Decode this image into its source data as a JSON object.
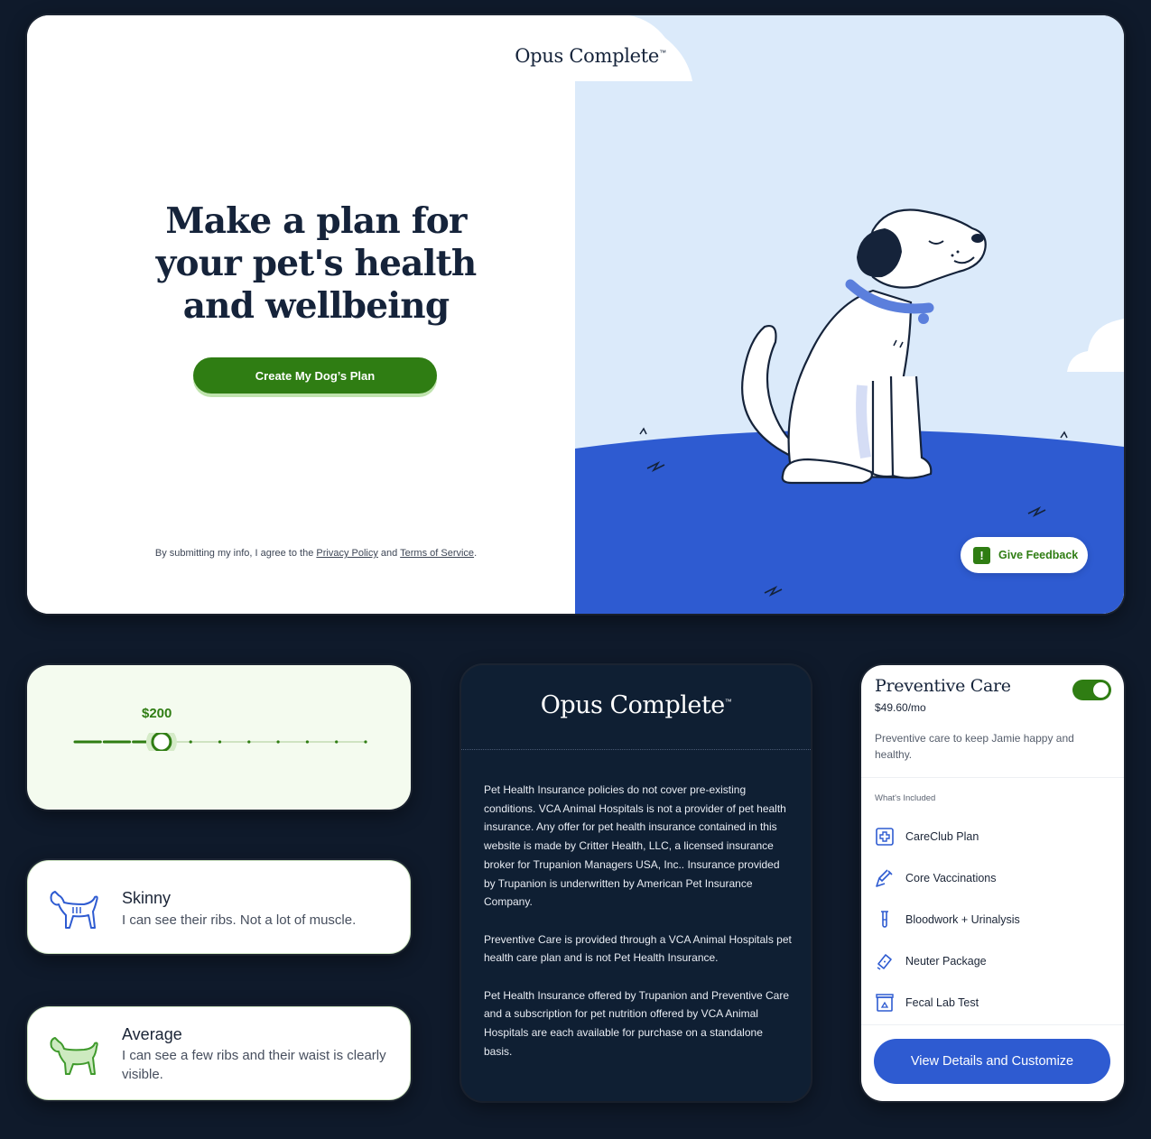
{
  "hero": {
    "brand": "Opus Complete",
    "brand_tm": "™",
    "title": "Make a plan for your pet's health and wellbeing",
    "cta_label": "Create My Dog’s Plan",
    "legal_prefix": "By submitting my info, I agree to the ",
    "privacy_link": "Privacy Policy",
    "legal_and": " and ",
    "terms_link": "Terms of Service",
    "legal_suffix": ".",
    "feedback_label": "Give Feedback",
    "feedback_icon": "!"
  },
  "slider": {
    "value_label": "$200",
    "selected_index": 3,
    "step_count": 11
  },
  "body_types": [
    {
      "title": "Skinny",
      "description": "I can see their ribs. Not a lot of muscle.",
      "icon": "skinny-dog-icon",
      "color": "#2e5bd1"
    },
    {
      "title": "Average",
      "description": "I can see a few ribs and their waist is clearly visible.",
      "icon": "average-dog-icon",
      "color": "#3f9a2c"
    }
  ],
  "disclaimer": {
    "brand": "Opus Complete",
    "brand_tm": "™",
    "paragraphs": [
      "Pet Health Insurance policies do not cover pre-existing conditions.  VCA Animal Hospitals is not a provider of pet health insurance. Any offer for pet health insurance contained in this website is made by Critter Health, LLC, a licensed insurance broker for Trupanion Managers USA, Inc.. Insurance provided by Trupanion is underwritten by American Pet Insurance Company.",
      "Preventive Care is provided through a VCA Animal Hospitals pet health care plan and is not Pet Health Insurance.",
      "Pet Health Insurance offered by Trupanion and Preventive Care and a subscription for pet nutrition offered by VCA Animal Hospitals are each available for purchase on a standalone basis."
    ]
  },
  "plan": {
    "title": "Preventive Care",
    "price": "$49.60/mo",
    "toggle_on": true,
    "description": "Preventive care to keep Jamie happy and healthy.",
    "included_label": "What's Included",
    "items": [
      {
        "label": "CareClub Plan",
        "icon": "medical-cross-icon"
      },
      {
        "label": "Core Vaccinations",
        "icon": "syringe-icon"
      },
      {
        "label": "Bloodwork + Urinalysis",
        "icon": "test-tube-icon"
      },
      {
        "label": "Neuter Package",
        "icon": "bandage-icon"
      },
      {
        "label": "Fecal Lab Test",
        "icon": "lab-container-icon"
      }
    ],
    "button_label": "View Details and Customize"
  },
  "colors": {
    "brand_green": "#2f7d13",
    "brand_blue": "#2e5bd1",
    "navy": "#0f1f33",
    "sky": "#dbeafa"
  }
}
